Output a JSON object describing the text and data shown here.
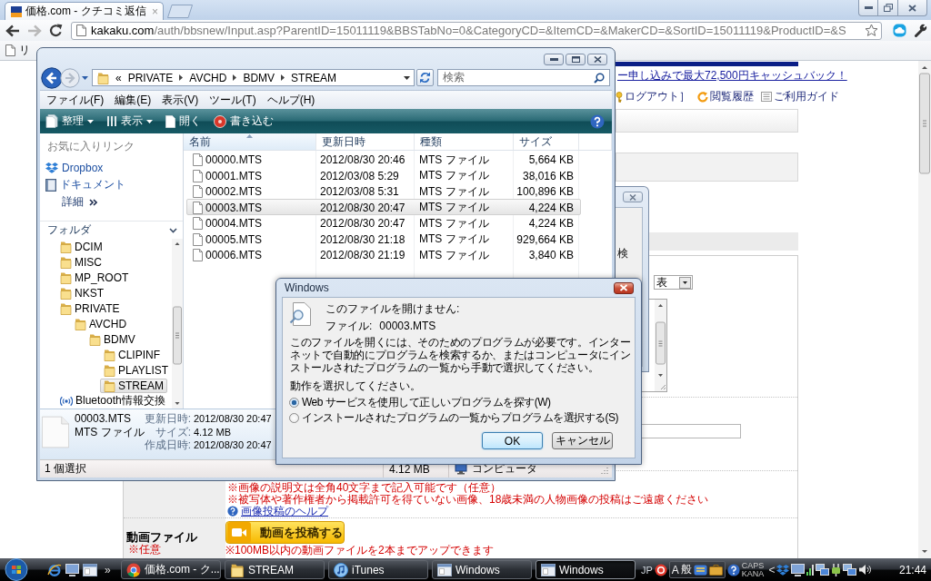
{
  "browser": {
    "tabs": [
      {
        "title": "価格.com - クチコミ返信",
        "close": "×",
        "selected": true
      }
    ],
    "address": {
      "host": "kakaku.com",
      "path": "/auth/bbsnew/Input.asp?ParentID=15011119&BBSTabNo=0&CategoryCD=&ItemCD=&MakerCD=&SortID=15011119&ProductID=&S"
    },
    "bookmarks": [
      {
        "label": "リ"
      }
    ],
    "page": {
      "promo_link": "ー申し込みで最大72,500円キャッシュバック！",
      "header_links": [
        {
          "kind": "logout",
          "label": "ログアウト］"
        },
        {
          "kind": "history",
          "label": "閲覧履歴"
        },
        {
          "kind": "guide",
          "label": "ご利用ガイド"
        }
      ],
      "select": {
        "value": "表"
      },
      "image_notes": [
        "※画像の説明文は全角40文字まで記入可能です（任意）",
        "※被写体や著作権者から掲載許可を得ていない画像、18歳未満の人物画像の投稿はご遠慮ください"
      ],
      "help_link": "画像投稿のヘルプ",
      "video": {
        "label": "動画ファイル",
        "optional": "※任意",
        "button": "動画を投稿する",
        "note": "※100MB以内の動画ファイルを2本までアップできます"
      }
    }
  },
  "explorer": {
    "breadcrumb": {
      "overflow": "«",
      "parts": [
        "PRIVATE",
        "AVCHD",
        "BDMV",
        "STREAM"
      ]
    },
    "search": {
      "placeholder": "検索"
    },
    "menu": [
      "ファイル(F)",
      "編集(E)",
      "表示(V)",
      "ツール(T)",
      "ヘルプ(H)"
    ],
    "toolbar": [
      {
        "kind": "organize",
        "label": "整理",
        "dropdown": true
      },
      {
        "kind": "views",
        "label": "表示",
        "dropdown": true
      },
      {
        "kind": "open",
        "label": "開く",
        "dropdown": false
      },
      {
        "kind": "burn",
        "label": "書き込む",
        "dropdown": false
      }
    ],
    "favorites": {
      "title": "お気に入りリンク",
      "items": [
        {
          "kind": "dropbox",
          "label": "Dropbox"
        },
        {
          "kind": "documents",
          "label": "ドキュメント"
        }
      ],
      "more": "詳細"
    },
    "folders": {
      "title": "フォルダ",
      "tree": [
        {
          "kind": "folder",
          "label": "DCIM",
          "selected": false
        },
        {
          "kind": "folder",
          "label": "MISC",
          "selected": false
        },
        {
          "kind": "folder",
          "label": "MP_ROOT",
          "selected": false
        },
        {
          "kind": "folder",
          "label": "NKST",
          "selected": false
        },
        {
          "kind": "folder",
          "label": "PRIVATE",
          "selected": false,
          "children": [
            {
              "kind": "folder",
              "label": "AVCHD",
              "selected": false,
              "children": [
                {
                  "kind": "folder",
                  "label": "BDMV",
                  "selected": false,
                  "children": [
                    {
                      "kind": "folder",
                      "label": "CLIPINF",
                      "selected": false
                    },
                    {
                      "kind": "folder",
                      "label": "PLAYLIST",
                      "selected": false
                    },
                    {
                      "kind": "folder",
                      "label": "STREAM",
                      "selected": true
                    }
                  ]
                }
              ]
            }
          ]
        },
        {
          "kind": "bluetooth",
          "label": "Bluetooth情報交換",
          "selected": false
        }
      ]
    },
    "files": {
      "columns": [
        {
          "label": "名前",
          "sorted": true
        },
        {
          "label": "更新日時",
          "sorted": false
        },
        {
          "label": "種類",
          "sorted": false
        },
        {
          "label": "サイズ",
          "sorted": false
        }
      ],
      "rows": [
        {
          "name": "00000.MTS",
          "modified": "2012/08/30 20:46",
          "type": "MTS ファイル",
          "size": "5,664 KB",
          "selected": false
        },
        {
          "name": "00001.MTS",
          "modified": "2012/03/08 5:29",
          "type": "MTS ファイル",
          "size": "38,016 KB",
          "selected": false
        },
        {
          "name": "00002.MTS",
          "modified": "2012/03/08 5:31",
          "type": "MTS ファイル",
          "size": "100,896 KB",
          "selected": false
        },
        {
          "name": "00003.MTS",
          "modified": "2012/08/30 20:47",
          "type": "MTS ファイル",
          "size": "4,224 KB",
          "selected": true
        },
        {
          "name": "00004.MTS",
          "modified": "2012/08/30 20:47",
          "type": "MTS ファイル",
          "size": "4,224 KB",
          "selected": false
        },
        {
          "name": "00005.MTS",
          "modified": "2012/08/30 21:18",
          "type": "MTS ファイル",
          "size": "929,664 KB",
          "selected": false
        },
        {
          "name": "00006.MTS",
          "modified": "2012/08/30 21:19",
          "type": "MTS ファイル",
          "size": "3,840 KB",
          "selected": false
        }
      ]
    },
    "details": {
      "name": "00003.MTS",
      "type": "MTS ファイル",
      "fields": [
        {
          "label": "更新日時:",
          "value": "2012/08/30 20:47"
        },
        {
          "label": "サイズ:",
          "value": "4.12 MB"
        },
        {
          "label": "作成日時:",
          "value": "2012/08/30 20:47"
        }
      ]
    },
    "status": {
      "selection": "1 個選択",
      "size": "4.12 MB",
      "zone": "コンピュータ"
    }
  },
  "back_dialog": {
    "text": "検"
  },
  "dialog": {
    "title": "Windows",
    "heading": "このファイルを開けません:",
    "file_label": "ファイル:",
    "file_name": "00003.MTS",
    "message": "このファイルを開くには、そのためのプログラムが必要です。インターネットで自動的にプログラムを検索するか、またはコンピュータにインストールされたプログラムの一覧から手動で選択してください。",
    "prompt": "動作を選択してください。",
    "options": [
      {
        "label": "Web サービスを使用して正しいプログラムを探す(W)",
        "selected": true
      },
      {
        "label": "インストールされたプログラムの一覧からプログラムを選択する(S)",
        "selected": false
      }
    ],
    "buttons": [
      {
        "label": "OK",
        "default": true
      },
      {
        "label": "キャンセル",
        "default": false
      }
    ]
  },
  "taskbar": {
    "quick_launch": [
      {
        "kind": "browser"
      },
      {
        "kind": "desktop"
      },
      {
        "kind": "window"
      }
    ],
    "more": "»",
    "tasks": [
      {
        "kind": "chrome",
        "label": "価格.com - ク...",
        "active": false
      },
      {
        "kind": "folder",
        "label": "STREAM",
        "active": false
      },
      {
        "kind": "itunes",
        "label": "iTunes",
        "active": false
      },
      {
        "kind": "window",
        "label": "Windows",
        "active": false
      },
      {
        "kind": "window",
        "label": "Windows",
        "active": true
      }
    ],
    "tray": {
      "language": "JP",
      "input_mode": "A",
      "conversion_mode": "般",
      "caps": "CAPS",
      "kana": "KANA",
      "expand": "<",
      "clock": "21:44"
    }
  }
}
